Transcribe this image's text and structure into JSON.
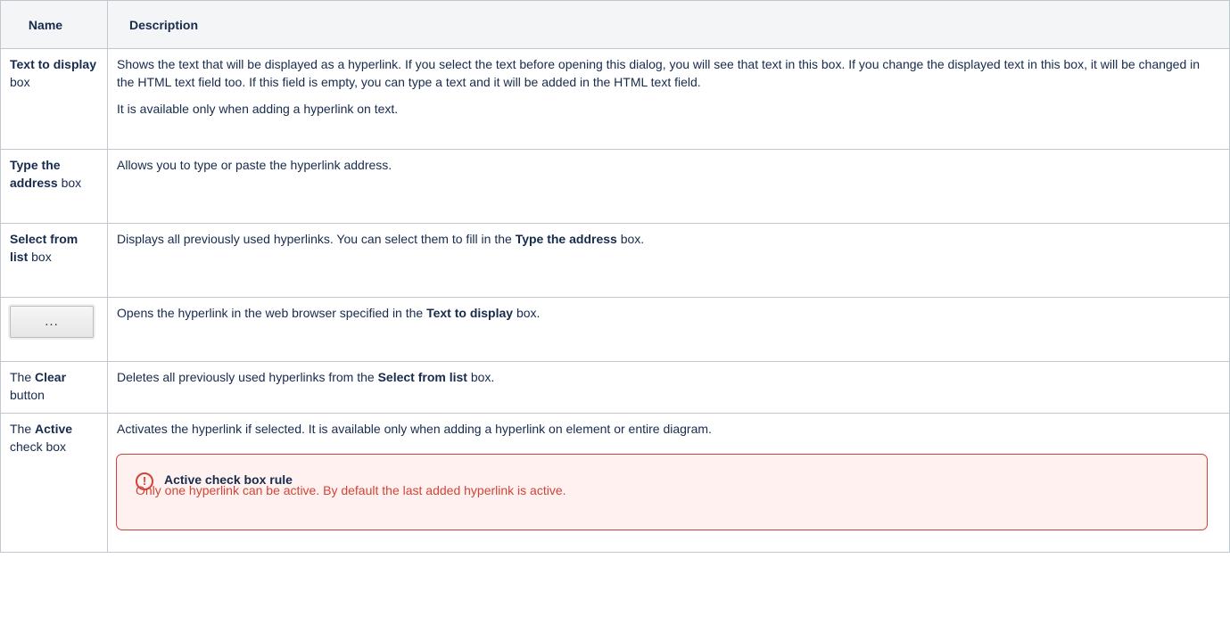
{
  "table": {
    "headers": {
      "name": "Name",
      "description": "Description"
    },
    "rows": [
      {
        "name_bold": "Text to display",
        "name_rest": " box",
        "desc_p1": "Shows the text that will be displayed as a hyperlink. If you select the text before opening this dialog, you will see that text in this box. If you change the displayed text in this box, it will be changed in the HTML text field too. If this field is empty, you can type a text and it will be added in the HTML text field.",
        "desc_p2": "It is available only when adding a hyperlink on text."
      },
      {
        "name_bold": "Type the address",
        "name_rest": " box",
        "desc": "Allows you to type or paste the hyperlink address."
      },
      {
        "name_bold": "Select from list",
        "name_rest": " box",
        "desc_before": "Displays all previously used hyperlinks. You can select them to fill in the ",
        "desc_bold": "Type the address",
        "desc_after": " box."
      },
      {
        "button_label": "...",
        "desc_before": "Opens the hyperlink in the web browser specified in the ",
        "desc_bold": "Text to display",
        "desc_after": " box."
      },
      {
        "name_prefix": "The ",
        "name_bold": "Clear",
        "name_rest": " button",
        "desc_before": "Deletes all previously used hyperlinks from the ",
        "desc_bold": "Select from list",
        "desc_after": " box."
      },
      {
        "name_prefix": "The ",
        "name_bold": "Active",
        "name_rest": " check box",
        "desc": "Activates the hyperlink if selected. It is available only when adding a hyperlink on element or entire diagram.",
        "alert": {
          "icon": "warning-circle-icon",
          "title": "Active check box rule",
          "body": "Only one hyperlink can be active. By default the last added hyperlink is active."
        }
      }
    ]
  }
}
